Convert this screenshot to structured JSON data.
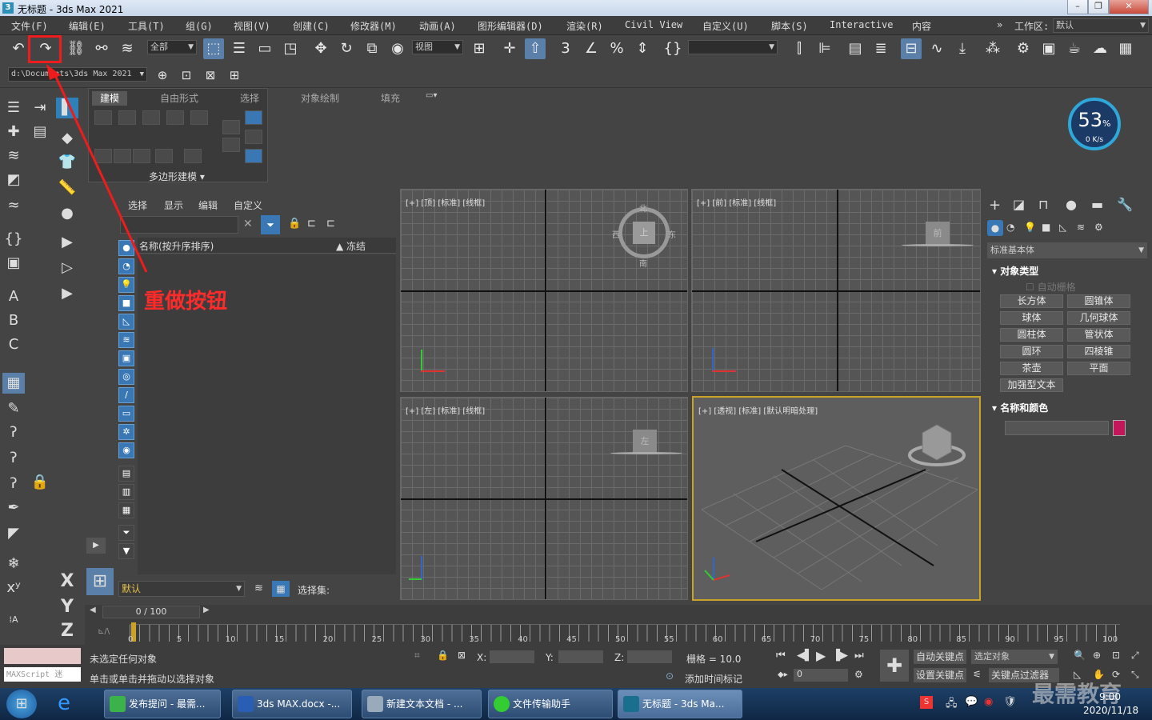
{
  "window": {
    "title": "无标题 - 3ds Max 2021"
  },
  "menu": [
    "文件(F)",
    "编辑(E)",
    "工具(T)",
    "组(G)",
    "视图(V)",
    "创建(C)",
    "修改器(M)",
    "动画(A)",
    "图形编辑器(D)",
    "渲染(R)",
    "Civil View",
    "自定义(U)",
    "脚本(S)",
    "Interactive",
    "内容"
  ],
  "workspace": {
    "label": "工作区:",
    "value": "默认"
  },
  "toolbar": {
    "selection_filter": "全部",
    "ref_coord": "视图",
    "named_set": ""
  },
  "path": "d:\\Documents\\3ds Max 2021",
  "ribbon": {
    "tabs": [
      "建模",
      "自由形式",
      "选择",
      "对象绘制",
      "填充"
    ],
    "group": "多边形建模"
  },
  "explorer": {
    "tabs": [
      "选择",
      "显示",
      "编辑",
      "自定义"
    ],
    "column_name": "名称(按升序排序)",
    "column_frozen": "▲ 冻结",
    "layer": "默认",
    "selset_label": "选择集:"
  },
  "viewports": {
    "top": "[+] [顶] [标准] [线框]",
    "front": "[+] [前] [标准] [线框]",
    "left": "[+] [左] [标准] [线框]",
    "persp": "[+] [透视] [标准] [默认明暗处理]"
  },
  "viewcube": {
    "top": "上",
    "front": "前",
    "left": "左",
    "n": "北",
    "s": "南",
    "e": "东",
    "w": "西"
  },
  "cpu": {
    "percent": "53",
    "unit": "%",
    "speed": "0 K/s"
  },
  "command_panel": {
    "category": "标准基本体",
    "object_type": "对象类型",
    "autogrid": "自动栅格",
    "buttons": [
      "长方体",
      "圆锥体",
      "球体",
      "几何球体",
      "圆柱体",
      "管状体",
      "圆环",
      "四棱锥",
      "茶壶",
      "平面",
      "加强型文本"
    ],
    "name_color": "名称和颜色",
    "swatch_color": "#c2185b"
  },
  "timeline": {
    "frame": "0 / 100",
    "ticks": [
      "0",
      "5",
      "10",
      "15",
      "20",
      "25",
      "30",
      "35",
      "40",
      "45",
      "50",
      "55",
      "60",
      "65",
      "70",
      "75",
      "80",
      "85",
      "90",
      "95",
      "100"
    ]
  },
  "status": {
    "line1": "未选定任何对象",
    "line2": "单击或单击并拖动以选择对象",
    "maxscript": "MAXScript 迷",
    "x": "X:",
    "y": "Y:",
    "z": "Z:",
    "grid": "栅格 = 10.0",
    "add_time_tag": "添加时间标记",
    "auto_key": "自动关键点",
    "selected": "选定对象",
    "set_key": "设置关键点",
    "key_filter": "关键点过滤器",
    "frame_field": "0"
  },
  "annotation": {
    "text": "重做按钮"
  },
  "taskbar": {
    "items": [
      "发布提问 - 最需...",
      "3ds MAX.docx -...",
      "新建文本文档 - ...",
      "文件传输助手",
      "无标题 - 3ds Ma..."
    ],
    "time": "9:00",
    "date": "2020/11/18",
    "watermark": "最需教育"
  }
}
